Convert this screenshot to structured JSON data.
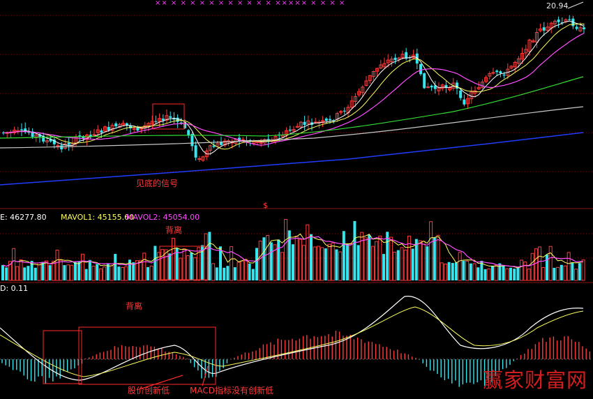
{
  "colors": {
    "up": "#ff3c3c",
    "down": "#35e6ef",
    "ma5": "#ffffff",
    "ma10": "#ffff60",
    "ma20": "#ff4dff",
    "ma60": "#33dd33",
    "ma120": "#c8c8c8",
    "ma250": "#1f3cff",
    "annotation": "#ff2a2a",
    "grid": "#7a1010"
  },
  "price_panel": {
    "high_label": "20.94",
    "signal_label": "见底的信号",
    "dollar_mark": "$",
    "top_marks": "××  × × ×     ×        × ×   ×       ×       ×    × × ×××××  ×   ×        ×  ×"
  },
  "volume_panel": {
    "legend_vol": "E: 46277.80",
    "legend_mavol1": "MAVOL1: 45155.60",
    "legend_mavol2": "MAVOL2: 45054.00",
    "divergence_label": "背离"
  },
  "macd_panel": {
    "legend": "D: 0.11",
    "divergence_label": "背离",
    "note_price": "股价创新低",
    "note_macd": "MACD指标没有创新低",
    "watermark": "赢家财富网"
  },
  "chart_data": [
    {
      "type": "candlestick",
      "title": "",
      "overlays": [
        "MA5",
        "MA10",
        "MA20",
        "MA60",
        "MA120",
        "MA250"
      ],
      "annotations": [
        "见底的信号",
        "20.94"
      ]
    },
    {
      "type": "bar",
      "series": [
        {
          "name": "VOL",
          "last": 46277.8
        },
        {
          "name": "MAVOL1",
          "last": 45155.6
        },
        {
          "name": "MAVOL2",
          "last": 45054.0
        }
      ],
      "annotations": [
        "背离"
      ]
    },
    {
      "type": "line",
      "series": [
        {
          "name": "D",
          "last": 0.11
        }
      ],
      "annotations": [
        "背离",
        "股价创新低",
        "MACD指标没有创新低"
      ]
    }
  ]
}
